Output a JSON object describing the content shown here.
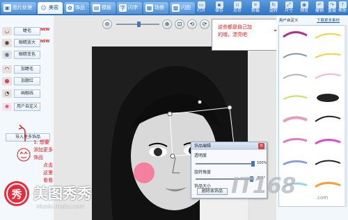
{
  "topbar": {
    "tabs": [
      {
        "label": "图片处理",
        "icon": "picture-icon"
      },
      {
        "label": "美容",
        "icon": "face-icon"
      },
      {
        "label": "饰品",
        "icon": "gift-icon"
      },
      {
        "label": "模板",
        "icon": "template-icon"
      },
      {
        "label": "闪字",
        "icon": "flash-text-icon"
      },
      {
        "label": "场景",
        "icon": "scene-icon"
      },
      {
        "label": "闪图",
        "icon": "flash-image-icon"
      }
    ],
    "tools": [
      {
        "label": "打开",
        "icon": "open-icon"
      },
      {
        "label": "保存",
        "icon": "save-icon"
      },
      {
        "label": "另存",
        "icon": "save-as-icon"
      },
      {
        "label": "剪裁",
        "icon": "crop-icon"
      },
      {
        "label": "旋转",
        "icon": "rotate-icon"
      },
      {
        "label": "尺寸",
        "icon": "resize-icon"
      },
      {
        "label": "预览",
        "icon": "preview-icon"
      },
      {
        "label": "撤销",
        "icon": "undo-icon"
      },
      {
        "label": "重做",
        "icon": "redo-icon"
      },
      {
        "label": "帮助",
        "icon": "help-icon"
      }
    ]
  },
  "left": {
    "items": [
      {
        "label": "睫毛",
        "badge": "NEW"
      },
      {
        "label": "眼睛放大",
        "badge": "NEW"
      },
      {
        "label": "眼睛变色",
        "badge": ""
      },
      {
        "label": "加睫毛",
        "badge": ""
      },
      {
        "label": "加腮红",
        "badge": ""
      },
      {
        "label": "画眼线",
        "badge": ""
      },
      {
        "label": "用户自定义",
        "badge": ""
      }
    ],
    "add_more": "导入更多饰品"
  },
  "annotations": {
    "left_note_line1": "1. 想要添加更多饰品",
    "left_note_line2": "点击这里看看",
    "right_note_line1": "这些都是自己加",
    "right_note_line2": "的哦，漂亮吧"
  },
  "right": {
    "tab_label": "用户自定义",
    "link_label": "下载更多素材"
  },
  "dialog": {
    "title": "饰品编辑",
    "opacity_label": "透明度",
    "opacity_value": "100%",
    "rotation_label": "旋转角度",
    "rotation_value": "355°",
    "size_label": "饰品大小",
    "delete_label": "删除本饰品"
  },
  "branding": {
    "logo_text": "美图秀秀",
    "logo_url": "xiuxiu.meitu.com",
    "watermark": "IT168",
    "watermark_com": ".com"
  }
}
